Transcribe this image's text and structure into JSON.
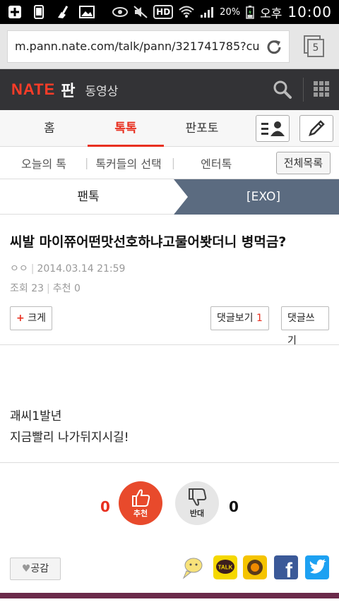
{
  "status": {
    "battery": "20%",
    "ampm": "오후",
    "time": "10:00",
    "hd": "HD"
  },
  "browser": {
    "url": "m.pann.nate.com/talk/pann/321741785?cu",
    "tab_count": "5"
  },
  "header": {
    "logo": "NATE",
    "pan": "판",
    "video": "동영상"
  },
  "main_tabs": [
    {
      "label": "홈"
    },
    {
      "label": "톡톡"
    },
    {
      "label": "판포토"
    }
  ],
  "sub_tabs": {
    "items": [
      "오늘의 톡",
      "톡커들의 선택",
      "엔터톡"
    ],
    "all_list": "전체목록"
  },
  "crumb": {
    "left": "팬톡",
    "right": "[EXO]"
  },
  "article": {
    "title": "씨발 마이쮸어떤맛선호하냐고물어봣더니 병먹금?",
    "author": "ㅇㅇ",
    "date": "2014.03.14 21:59",
    "views_label": "조회",
    "views": "23",
    "recommend_label": "추천",
    "recommend": "0",
    "bigger_label": "크게",
    "comments_view_label": "댓글보기",
    "comments_count": "1",
    "comment_write_label": "댓글쓰기",
    "body_line1": "괘씨1발년",
    "body_line2": "지금빨리 나가뒤지시길!"
  },
  "votes": {
    "up_count": "0",
    "up_label": "추천",
    "down_count": "0",
    "down_label": "반대"
  },
  "bottom": {
    "empathy_label": "공감",
    "share_icons": [
      "comment-icon",
      "kakaotalk-icon",
      "kakaostory-icon",
      "facebook-icon",
      "twitter-icon"
    ],
    "kakao_label": "TALK",
    "facebook_glyph": "f"
  },
  "colors": {
    "accent": "#e83020",
    "header_bg": "#333336",
    "crumb_active": "#5b6b80"
  }
}
